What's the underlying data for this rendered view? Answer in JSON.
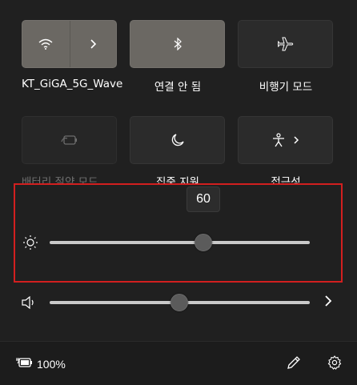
{
  "tiles": [
    {
      "name": "wifi",
      "label": "KT_GiGA_5G_Wave",
      "state": "on",
      "icon": "wifi-icon",
      "secondary_icon": "chevron-right-icon"
    },
    {
      "name": "bluetooth",
      "label": "연결 안 됨",
      "state": "on",
      "icon": "bluetooth-icon"
    },
    {
      "name": "airplane",
      "label": "비행기 모드",
      "state": "off",
      "icon": "airplane-icon"
    },
    {
      "name": "battery-saver",
      "label": "배터리 절약 모드",
      "state": "disabled",
      "icon": "battery-saver-icon"
    },
    {
      "name": "focus-assist",
      "label": "집중 지원",
      "state": "off",
      "icon": "moon-icon"
    },
    {
      "name": "accessibility",
      "label": "접근성",
      "state": "off",
      "icon": "accessibility-icon",
      "secondary_icon": "chevron-right-icon"
    }
  ],
  "brightness": {
    "value": 60,
    "tooltip": "60",
    "icon": "sun-icon"
  },
  "volume": {
    "level": 0.5,
    "icon": "speaker-icon",
    "more_icon": "chevron-right-icon"
  },
  "footer": {
    "battery_text": "100%",
    "battery_icon": "battery-charging-icon",
    "edit_icon": "pencil-icon",
    "settings_icon": "gear-icon"
  },
  "colors": {
    "tile_on": "#6b6863",
    "tile_off": "#2b2b2b",
    "highlight": "#d21f1f",
    "background": "#202020"
  }
}
